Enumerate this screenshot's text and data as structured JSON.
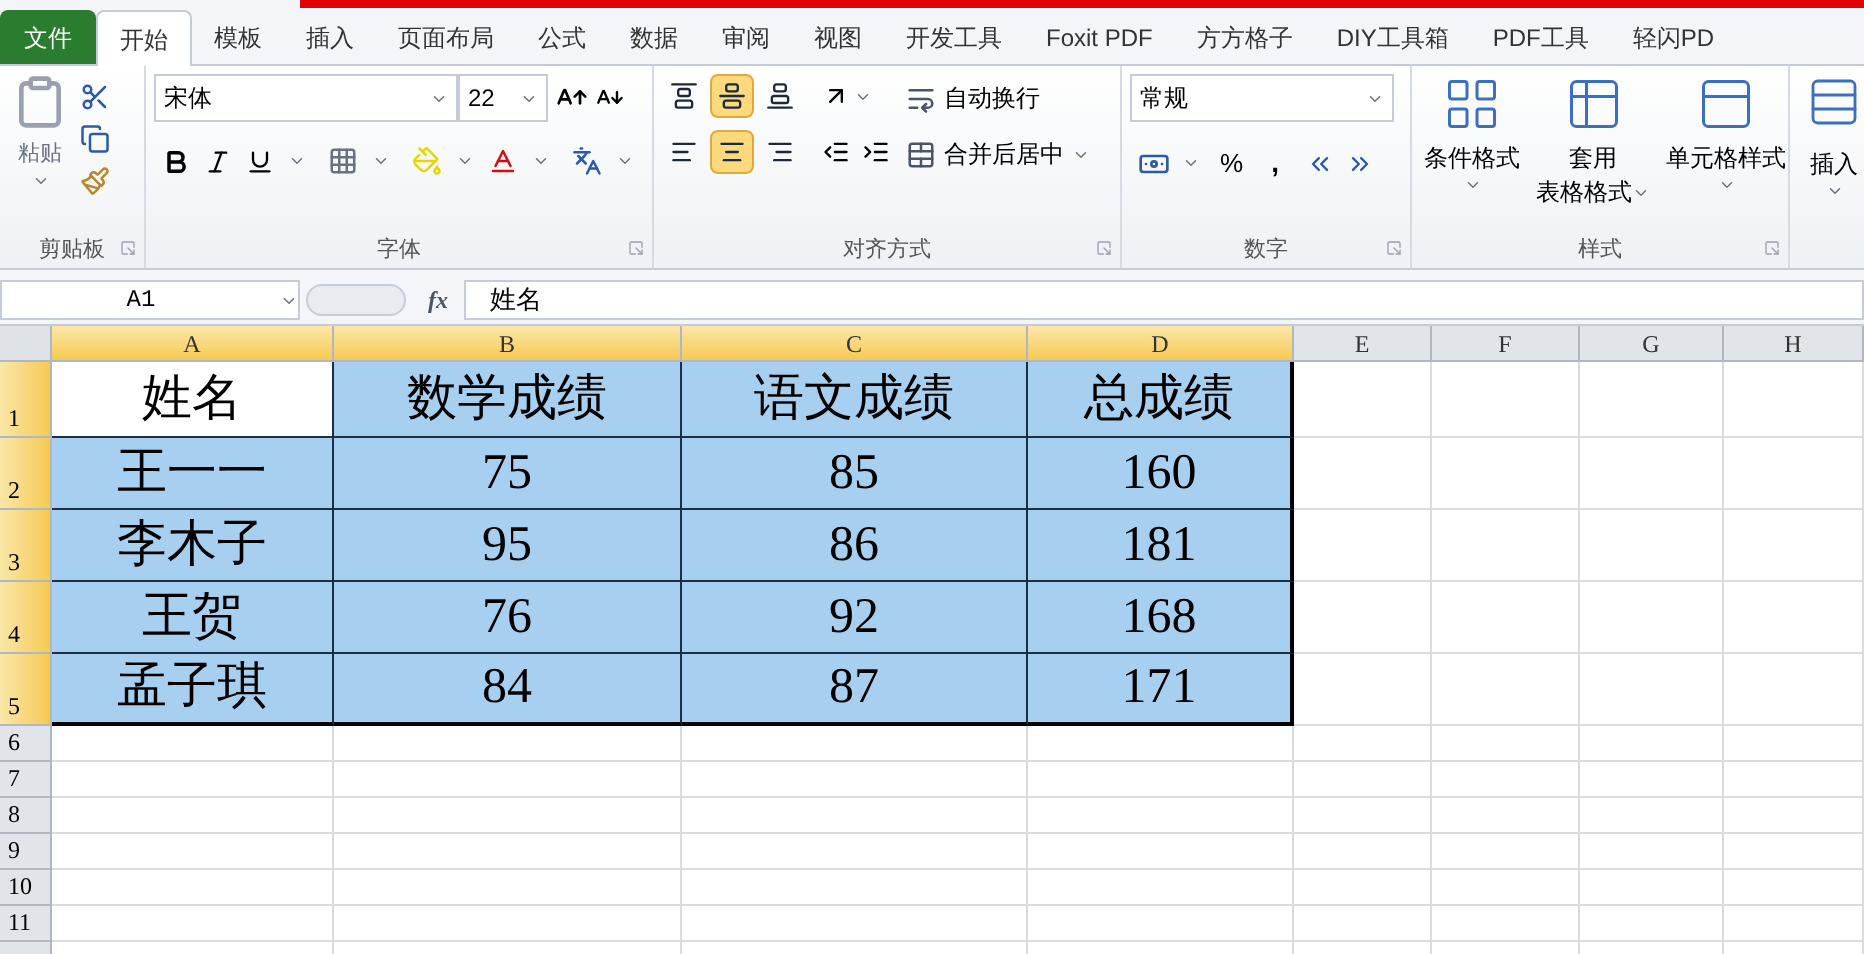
{
  "file_tab": "文件",
  "tabs": [
    {
      "label": "开始",
      "selected": true
    },
    {
      "label": "模板",
      "selected": false
    },
    {
      "label": "插入",
      "selected": false
    },
    {
      "label": "页面布局",
      "selected": false
    },
    {
      "label": "公式",
      "selected": false
    },
    {
      "label": "数据",
      "selected": false
    },
    {
      "label": "审阅",
      "selected": false
    },
    {
      "label": "视图",
      "selected": false
    },
    {
      "label": "开发工具",
      "selected": false
    },
    {
      "label": "Foxit PDF",
      "selected": false
    },
    {
      "label": "方方格子",
      "selected": false
    },
    {
      "label": "DIY工具箱",
      "selected": false
    },
    {
      "label": "PDF工具",
      "selected": false
    },
    {
      "label": "轻闪PD",
      "selected": false
    }
  ],
  "clipboard": {
    "paste": "粘贴",
    "label": "剪贴板"
  },
  "font": {
    "name": "宋体",
    "size": "22",
    "label": "字体"
  },
  "alignment": {
    "buttons": [
      {
        "kind": "top",
        "selected": false
      },
      {
        "kind": "middle",
        "selected": true
      },
      {
        "kind": "bottom",
        "selected": false
      },
      {
        "kind": "left",
        "selected": false
      },
      {
        "kind": "center",
        "selected": true
      },
      {
        "kind": "right",
        "selected": false
      }
    ],
    "wrap": "自动换行",
    "merge": "合并后居中",
    "label": "对齐方式"
  },
  "number": {
    "format": "常规",
    "percent": "%",
    "comma": ",",
    "label": "数字"
  },
  "styles": {
    "buttons": [
      {
        "kind": "conditional",
        "lines": [
          "条件格式"
        ]
      },
      {
        "kind": "table",
        "lines": [
          "套用",
          "表格格式"
        ]
      },
      {
        "kind": "cell",
        "lines": [
          "单元格样式"
        ]
      }
    ],
    "label": "样式"
  },
  "cells": {
    "insert": "插入"
  },
  "formula_bar": {
    "name_box": "A1",
    "fx": "fx",
    "formula": "姓名"
  },
  "columns": [
    {
      "label": "A",
      "selected": true
    },
    {
      "label": "B",
      "selected": true
    },
    {
      "label": "C",
      "selected": true
    },
    {
      "label": "D",
      "selected": true
    },
    {
      "label": "E",
      "selected": false
    },
    {
      "label": "F",
      "selected": false
    },
    {
      "label": "G",
      "selected": false
    },
    {
      "label": "H",
      "selected": false
    }
  ],
  "rows": [
    {
      "number": "1",
      "selected": true,
      "cells": [
        {
          "text": "姓名",
          "active": true
        },
        {
          "text": "数学成绩",
          "active": false
        },
        {
          "text": "语文成绩",
          "active": false
        },
        {
          "text": "总成绩",
          "active": false
        }
      ]
    },
    {
      "number": "2",
      "selected": true,
      "cells": [
        {
          "text": "王一一",
          "active": false
        },
        {
          "text": "75",
          "active": false
        },
        {
          "text": "85",
          "active": false
        },
        {
          "text": "160",
          "active": false
        }
      ]
    },
    {
      "number": "3",
      "selected": true,
      "cells": [
        {
          "text": "李木子",
          "active": false
        },
        {
          "text": "95",
          "active": false
        },
        {
          "text": "86",
          "active": false
        },
        {
          "text": "181",
          "active": false
        }
      ]
    },
    {
      "number": "4",
      "selected": true,
      "cells": [
        {
          "text": "王贺",
          "active": false
        },
        {
          "text": "76",
          "active": false
        },
        {
          "text": "92",
          "active": false
        },
        {
          "text": "168",
          "active": false
        }
      ]
    },
    {
      "number": "5",
      "selected": true,
      "cells": [
        {
          "text": "孟子琪",
          "active": false
        },
        {
          "text": "84",
          "active": false
        },
        {
          "text": "87",
          "active": false
        },
        {
          "text": "171",
          "active": false
        }
      ]
    },
    {
      "number": "6",
      "selected": false,
      "cells": []
    },
    {
      "number": "7",
      "selected": false,
      "cells": []
    },
    {
      "number": "8",
      "selected": false,
      "cells": []
    },
    {
      "number": "9",
      "selected": false,
      "cells": []
    },
    {
      "number": "10",
      "selected": false,
      "cells": []
    },
    {
      "number": "11",
      "selected": false,
      "cells": []
    }
  ]
}
